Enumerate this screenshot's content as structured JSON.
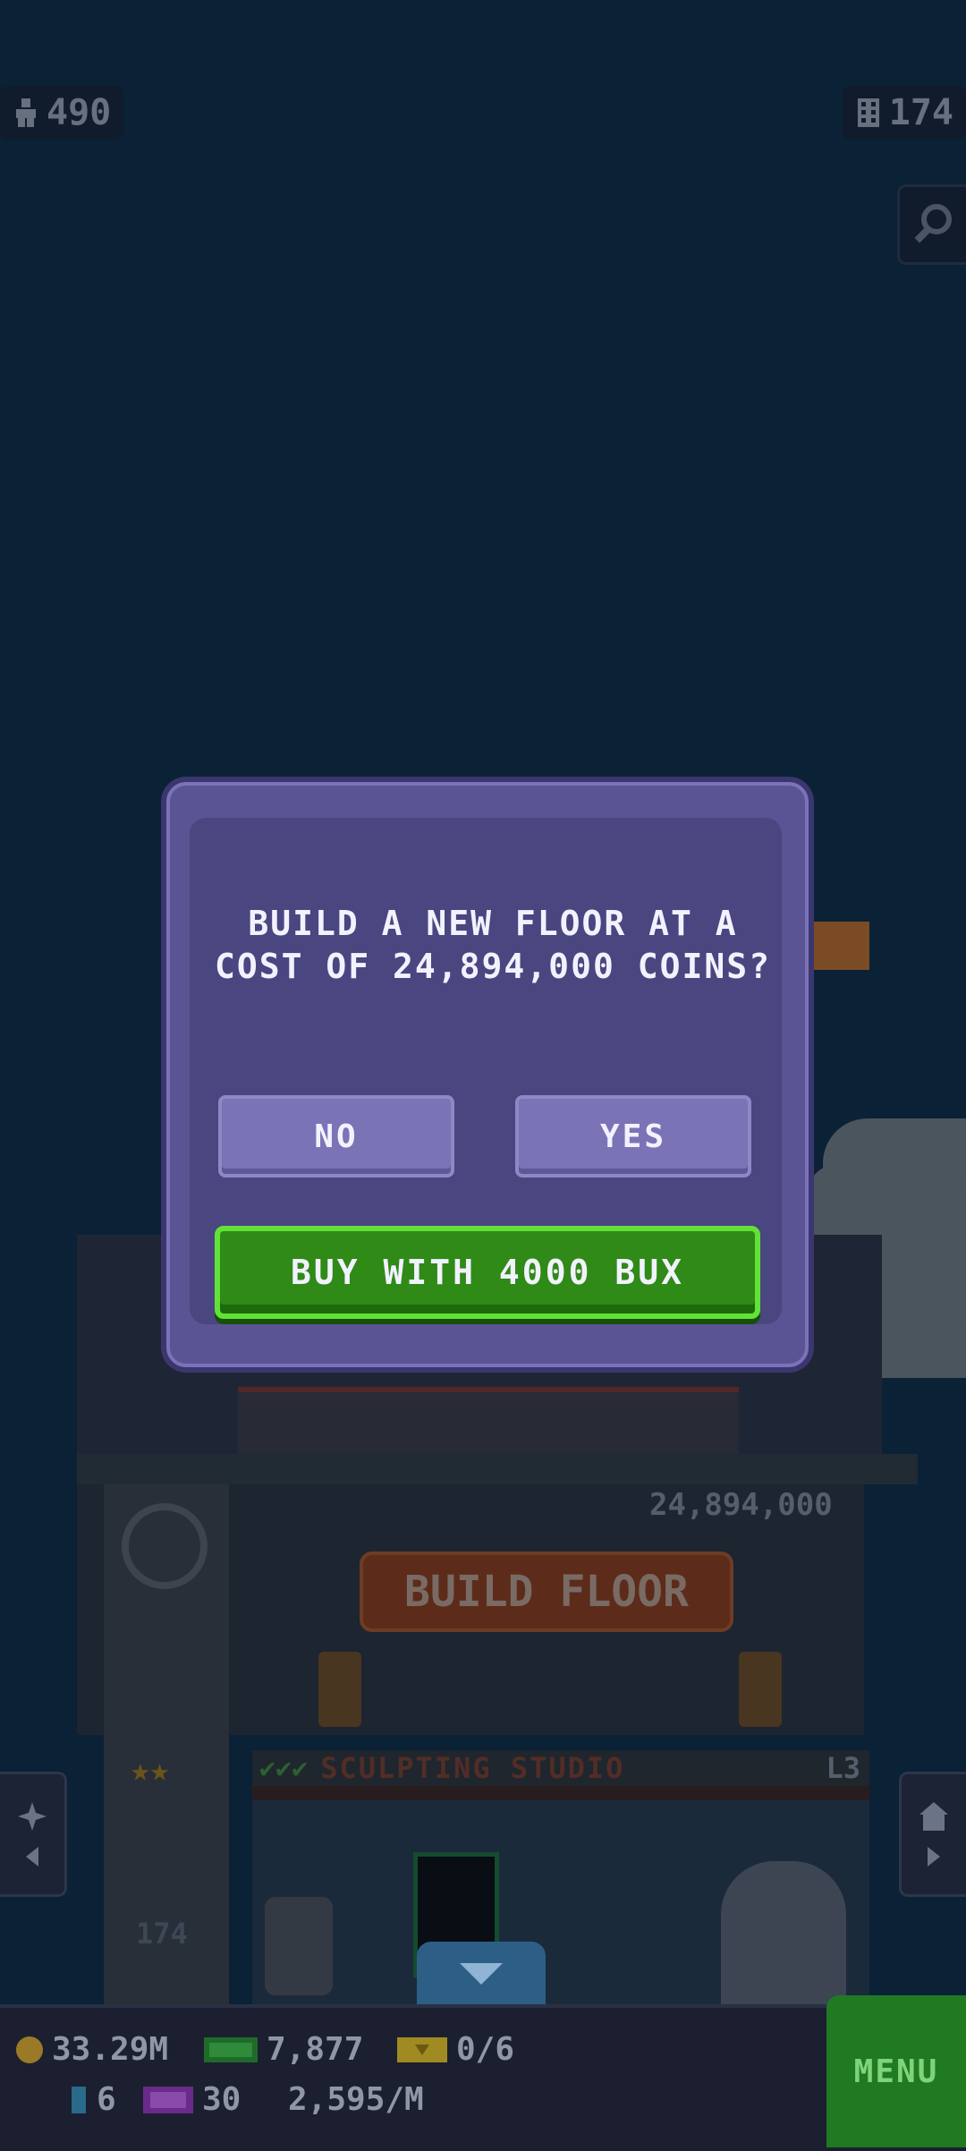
{
  "hud": {
    "population": "490",
    "floors": "174",
    "icons": {
      "population": "person-icon",
      "floors": "building-icon",
      "zoom": "magnifier-icon"
    }
  },
  "tower": {
    "build_cost": "24,894,000",
    "build_sign": "BUILD FLOOR",
    "floor_name": "SCULPTING STUDIO",
    "floor_level": "L3",
    "elevator_floor": "174"
  },
  "dialog": {
    "message": "BUILD A NEW FLOOR AT A COST OF 24,894,000 COINS?",
    "no_label": "NO",
    "yes_label": "YES",
    "bux_label": "BUY WITH 4000 BUX"
  },
  "bottom": {
    "coins": "33.29M",
    "bux": "7,877",
    "tickets": "0/6",
    "gems": "6",
    "vip": "30",
    "rate": "2,595/M",
    "menu_label": "MENU"
  },
  "colors": {
    "sky": "#0b2a44",
    "dialog": "#5b5494",
    "dialog_inner": "#4a4680",
    "button": "#7a74b6",
    "bux_green": "#2f8a17",
    "menu_green": "#1f7a22"
  }
}
